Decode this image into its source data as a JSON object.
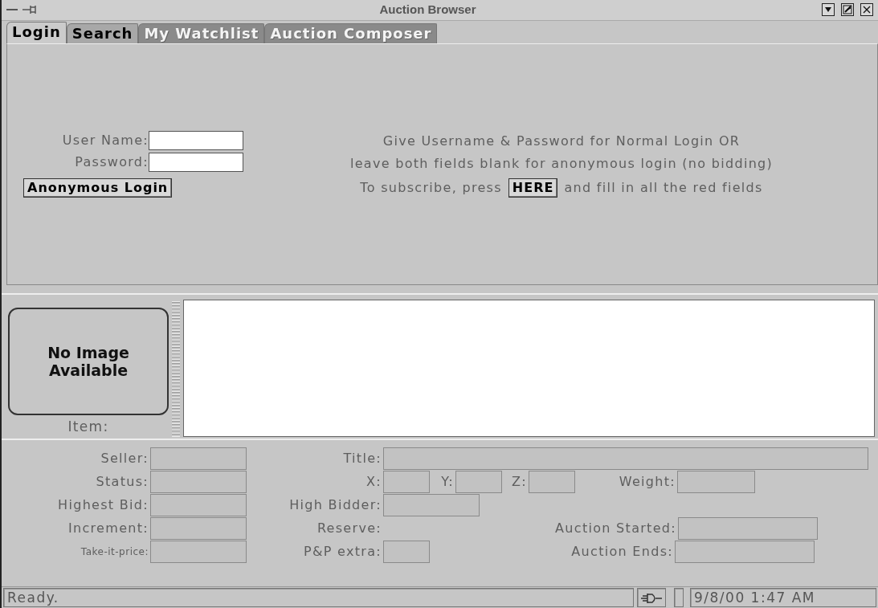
{
  "window": {
    "title": "Auction Browser"
  },
  "tabs": [
    {
      "label": "Login",
      "selected": true,
      "disabled": false
    },
    {
      "label": "Search",
      "selected": false,
      "disabled": false
    },
    {
      "label": "My Watchlist",
      "selected": false,
      "disabled": true
    },
    {
      "label": "Auction Composer",
      "selected": false,
      "disabled": true
    }
  ],
  "login": {
    "user_name_label": "User Name:",
    "password_label": "Password:",
    "anonymous_button": "Anonymous Login",
    "instructions": [
      "Give Username & Password for Normal Login OR",
      "leave both fields blank for anonymous login (no bidding)"
    ],
    "subscribe_before": "To subscribe, press",
    "subscribe_button": "HERE",
    "subscribe_after": "and fill in all  the red fields"
  },
  "item": {
    "image_text": "No Image Available",
    "label": "Item:"
  },
  "details": [
    [
      {
        "label": "Seller:",
        "kind": "normal",
        "field": true
      },
      {
        "label": "Title:",
        "kind": "normal",
        "field": true
      }
    ],
    [
      {
        "label": "Status:",
        "kind": "normal",
        "field": true
      },
      {
        "label": "X:",
        "kind": "normal",
        "field": true
      },
      {
        "label": "Y:",
        "kind": "normal",
        "field": true
      },
      {
        "label": "Z:",
        "kind": "normal",
        "field": true
      },
      {
        "label": "Weight:",
        "kind": "normal",
        "field": true
      }
    ],
    [
      {
        "label": "Highest Bid:",
        "kind": "normal",
        "field": true
      },
      {
        "label": "High Bidder:",
        "kind": "normal",
        "field": true
      }
    ],
    [
      {
        "label": "Increment:",
        "kind": "normal",
        "field": true
      },
      {
        "label": "Reserve:",
        "kind": "normal",
        "field": false
      },
      {
        "label": "Auction Started:",
        "kind": "normal",
        "field": true
      }
    ],
    [
      {
        "label": "Take-it-price:",
        "kind": "small",
        "field": true
      },
      {
        "label": "P&P extra:",
        "kind": "normal",
        "field": true
      },
      {
        "label": "Auction Ends:",
        "kind": "normal",
        "field": true
      }
    ]
  ],
  "status_bar": {
    "message": "Ready.",
    "datetime": "9/8/00 1:47 AM"
  }
}
